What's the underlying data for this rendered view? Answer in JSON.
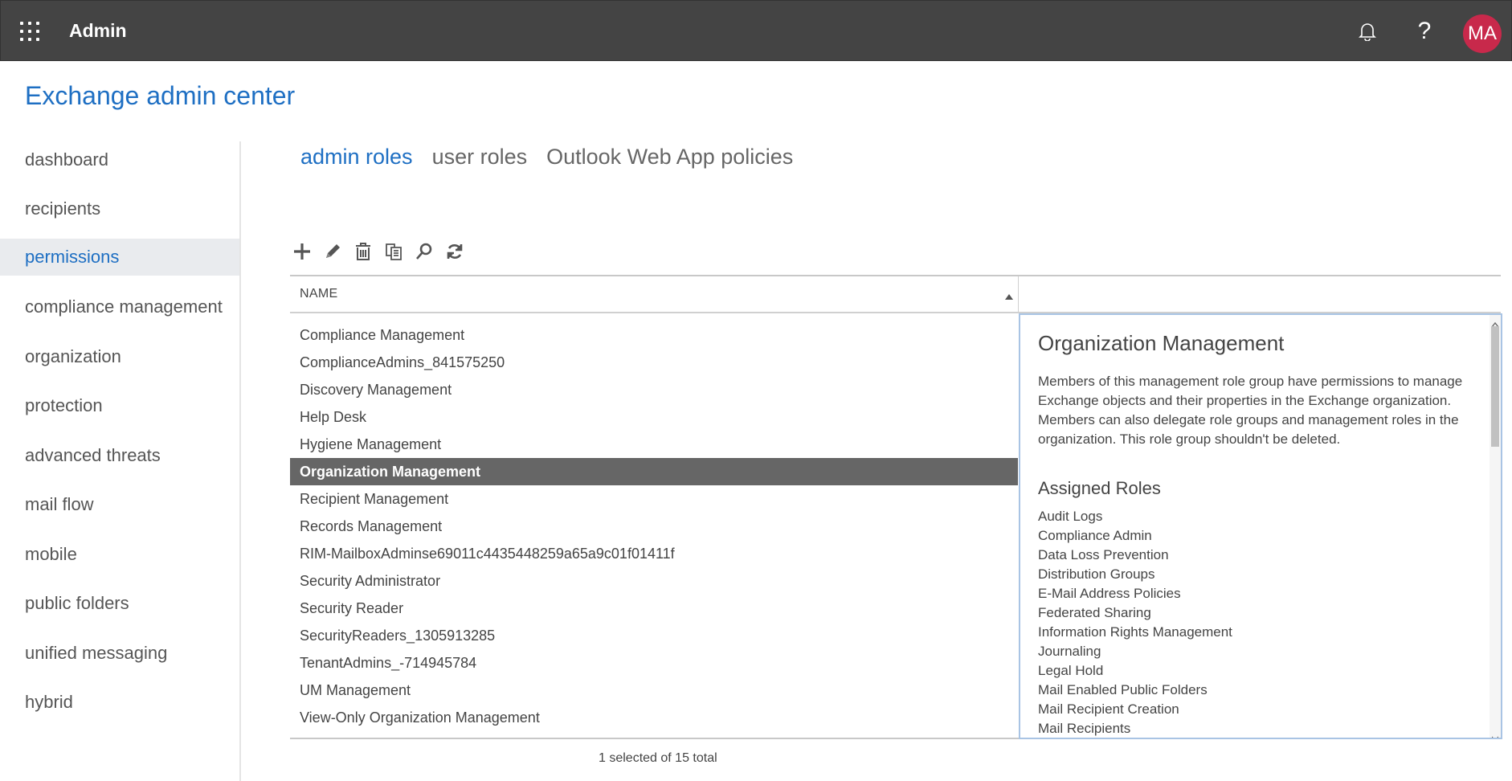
{
  "topbar": {
    "app_name": "Admin",
    "avatar_initials": "MA",
    "background_color": "#444444",
    "avatar_color": "#c8294b"
  },
  "page": {
    "title": "Exchange admin center",
    "accent_color": "#1e6fc3"
  },
  "leftnav": {
    "items": [
      {
        "label": "dashboard"
      },
      {
        "label": "recipients"
      },
      {
        "label": "permissions",
        "active": true
      },
      {
        "label": "compliance management"
      },
      {
        "label": "organization"
      },
      {
        "label": "protection"
      },
      {
        "label": "advanced threats"
      },
      {
        "label": "mail flow"
      },
      {
        "label": "mobile"
      },
      {
        "label": "public folders"
      },
      {
        "label": "unified messaging"
      },
      {
        "label": "hybrid"
      }
    ]
  },
  "tabs": [
    {
      "label": "admin roles",
      "active": true
    },
    {
      "label": "user roles"
    },
    {
      "label": "Outlook Web App policies"
    }
  ],
  "toolbar": {
    "icons": [
      "add-icon",
      "edit-icon",
      "delete-icon",
      "copy-icon",
      "search-icon",
      "refresh-icon"
    ]
  },
  "grid": {
    "column_name": "NAME",
    "rows": [
      "Compliance Management",
      "ComplianceAdmins_841575250",
      "Discovery Management",
      "Help Desk",
      "Hygiene Management",
      "Organization Management",
      "Recipient Management",
      "Records Management",
      "RIM-MailboxAdminse69011c4435448259a65a9c01f01411f",
      "Security Administrator",
      "Security Reader",
      "SecurityReaders_1305913285",
      "TenantAdmins_-714945784",
      "UM Management",
      "View-Only Organization Management"
    ],
    "selected_index": 5,
    "status": "1 selected of 15 total"
  },
  "detail": {
    "title": "Organization Management",
    "description": "Members of this management role group have permissions to manage Exchange objects and their properties in the Exchange organization. Members can also delegate role groups and management roles in the organization. This role group shouldn't be deleted.",
    "assigned_roles_heading": "Assigned Roles",
    "assigned_roles": [
      "Audit Logs",
      "Compliance Admin",
      "Data Loss Prevention",
      "Distribution Groups",
      "E-Mail Address Policies",
      "Federated Sharing",
      "Information Rights Management",
      "Journaling",
      "Legal Hold",
      "Mail Enabled Public Folders",
      "Mail Recipient Creation",
      "Mail Recipients"
    ]
  }
}
